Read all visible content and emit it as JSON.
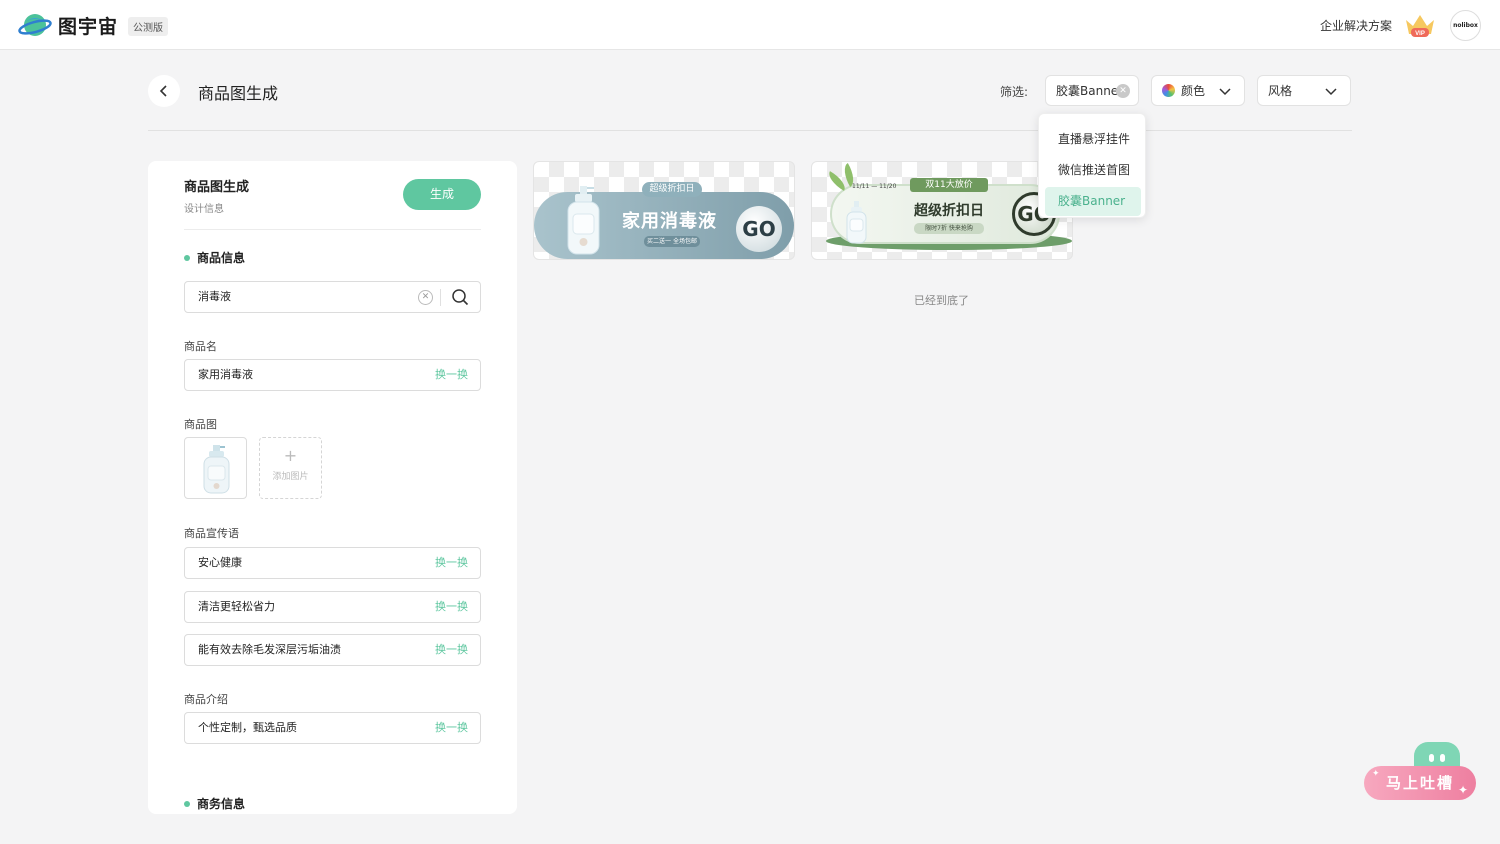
{
  "topbar": {
    "brand": "图宇宙",
    "beta_badge": "公测版",
    "enterprise_link": "企业解决方案",
    "vip_label": "VIP",
    "avatar_text": "nolibox"
  },
  "header": {
    "title": "商品图生成",
    "filter_label": "筛选:",
    "filter_banner": "胶囊Banner",
    "filter_color": "颜色",
    "filter_style": "风格"
  },
  "dropdown": {
    "items": [
      "直播悬浮挂件",
      "微信推送首图",
      "胶囊Banner"
    ]
  },
  "panel": {
    "title": "商品图生成",
    "subtitle": "设计信息",
    "generate_button": "生成",
    "section_product": "商品信息",
    "search_value": "消毒液",
    "name_label": "商品名",
    "name_value": "家用消毒液",
    "swap_label": "换一换",
    "image_label": "商品图",
    "add_image": "添加图片",
    "slogan_label": "商品宣传语",
    "slogans": [
      "安心健康",
      "清洁更轻松省力",
      "能有效去除毛发深层污垢油渍"
    ],
    "intro_label": "商品介绍",
    "intro_value": "个性定制，甄选品质",
    "section_business": "商务信息"
  },
  "cards": [
    {
      "tag": "超级折扣日",
      "main": "家用消毒液",
      "small": "买二送一 全场包邮",
      "go": "GO"
    },
    {
      "date": "11/11 — 11/20",
      "tag": "双11大放价",
      "main": "超级折扣日",
      "small": "限时7折 快来抢购",
      "go": "GO"
    }
  ],
  "end_note": "已经到底了",
  "feedback": {
    "label": "马上吐槽"
  },
  "colors": {
    "accent": "#5fc7a0",
    "dropdown_active_bg": "#dff4ec",
    "feedback_pink": "#ee7fa0"
  }
}
